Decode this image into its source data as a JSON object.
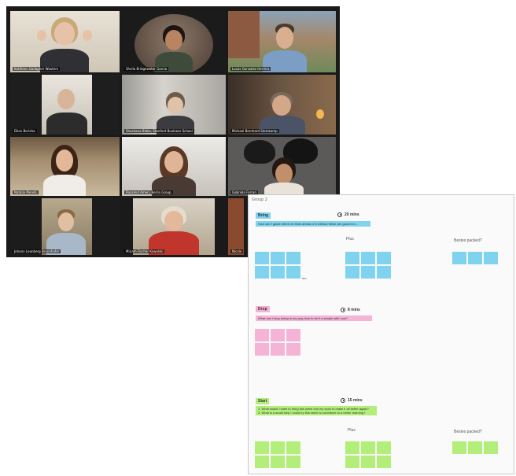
{
  "call": {
    "participants": [
      {
        "name": "Kathleen Gallagher Wauters"
      },
      {
        "name": "Sheila Bridgewater Garcia"
      },
      {
        "name": "Lucas Gonzalez Herrera"
      },
      {
        "name": "Dilan Berisha"
      },
      {
        "name": "Shoshana Blake, Stanford Business School"
      },
      {
        "name": "Michael Bernhard Steinkamp"
      },
      {
        "name": "Natalia Morelli"
      },
      {
        "name": "Rosalind Ameri, Berlin Group"
      },
      {
        "name": "Gabriela Ferrari"
      },
      {
        "name": "Johann Leonberg Brunnhofer"
      },
      {
        "name": "Mirjam Fischer Kowalski"
      },
      {
        "name": "Nicole"
      }
    ]
  },
  "board": {
    "title": "Group 2",
    "sections": [
      {
        "tag": "Bring",
        "time": "20 mins",
        "prompt": "How can I guide others to think ahead of it without these are good it in...",
        "mid_label": "Plus",
        "right_label": "Bestes packed?"
      },
      {
        "tag": "Drop",
        "time": "8 mins",
        "prompt": "What can I stop doing in my way how to be it a simple with now?"
      },
      {
        "tag": "Start",
        "time": "15 mins",
        "prompt_lines": [
          "1. What would I want to bring this week into my work to make it all better again?",
          "2. What is a small step I could try this week to contribute to a better learning?"
        ],
        "mid_label": "Plus",
        "right_label": "Bestes packed?"
      }
    ],
    "small_mark": "Mini"
  },
  "colors": {
    "blue": "#7fd3ee",
    "pink": "#f5b3d6",
    "green": "#b4ee7a",
    "active_speaker": "#c7d54a"
  }
}
